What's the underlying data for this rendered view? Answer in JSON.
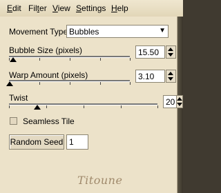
{
  "menu": [
    {
      "pre": "",
      "acc": "E",
      "post": "dit"
    },
    {
      "pre": "Fil",
      "acc": "t",
      "post": "er"
    },
    {
      "pre": "",
      "acc": "V",
      "post": "iew"
    },
    {
      "pre": "",
      "acc": "S",
      "post": "ettings"
    },
    {
      "pre": "",
      "acc": "H",
      "post": "elp"
    }
  ],
  "movement": {
    "label": "Movement Type:",
    "value": "Bubbles"
  },
  "bubble_size": {
    "label": "Bubble Size (pixels)",
    "value": "15.50"
  },
  "warp_amount": {
    "label": "Warp Amount (pixels)",
    "value": "3.10"
  },
  "twist": {
    "label": "Twist",
    "value": "20"
  },
  "seamless": {
    "label": "Seamless Tile",
    "checked": false
  },
  "random_seed": {
    "label": "Random Seed",
    "value": "1"
  },
  "watermark": "Titoune"
}
